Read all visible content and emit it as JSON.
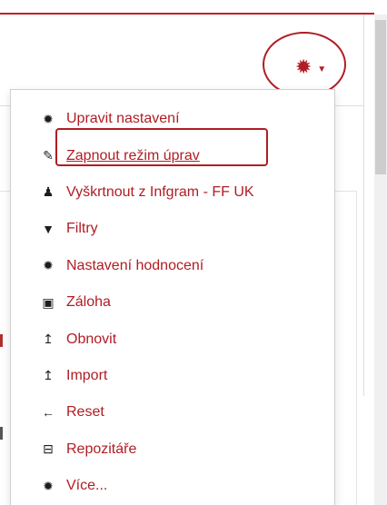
{
  "gear_menu": {
    "icon": "gear-icon",
    "caret_icon": "caret-down-icon",
    "accent_color": "#b01d24"
  },
  "menu": {
    "items": [
      {
        "label": "Upravit nastavení",
        "icon": "gear-icon"
      },
      {
        "label": "Zapnout režim úprav",
        "icon": "pencil-icon"
      },
      {
        "label": "Vyškrtnout z Infgram - FF UK",
        "icon": "user-icon"
      },
      {
        "label": "Filtry",
        "icon": "filter-icon"
      },
      {
        "label": "Nastavení hodnocení",
        "icon": "gear-icon"
      },
      {
        "label": "Záloha",
        "icon": "file-icon"
      },
      {
        "label": "Obnovit",
        "icon": "upload-arrow-icon"
      },
      {
        "label": "Import",
        "icon": "upload-arrow-icon"
      },
      {
        "label": "Reset",
        "icon": "arrow-left-icon"
      },
      {
        "label": "Repozitáře",
        "icon": "hdd-icon"
      },
      {
        "label": "Více...",
        "icon": "gear-icon"
      }
    ]
  }
}
